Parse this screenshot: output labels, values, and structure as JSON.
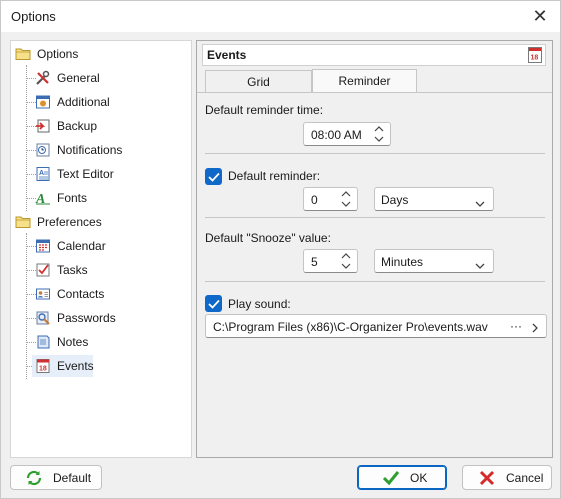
{
  "window": {
    "title": "Options",
    "close_glyph": "✕"
  },
  "tree": {
    "groups": [
      {
        "label": "Options",
        "icon": "folder-icon"
      },
      {
        "label": "Preferences",
        "icon": "folder-icon"
      }
    ],
    "options_items": [
      {
        "label": "General",
        "icon": "tools-icon"
      },
      {
        "label": "Additional",
        "icon": "settings-window-icon"
      },
      {
        "label": "Backup",
        "icon": "backup-icon"
      },
      {
        "label": "Notifications",
        "icon": "notifications-icon"
      },
      {
        "label": "Text Editor",
        "icon": "text-editor-icon"
      },
      {
        "label": "Fonts",
        "icon": "fonts-icon"
      }
    ],
    "preferences_items": [
      {
        "label": "Calendar",
        "icon": "calendar-icon"
      },
      {
        "label": "Tasks",
        "icon": "tasks-icon"
      },
      {
        "label": "Contacts",
        "icon": "contacts-icon"
      },
      {
        "label": "Passwords",
        "icon": "passwords-icon"
      },
      {
        "label": "Notes",
        "icon": "notes-icon"
      },
      {
        "label": "Events",
        "icon": "events-icon",
        "selected": true
      }
    ]
  },
  "panel": {
    "title": "Events",
    "header_icon": "events-icon",
    "icon_text": "18",
    "tabs": [
      {
        "label": "Grid",
        "active": false
      },
      {
        "label": "Reminder",
        "active": true
      }
    ],
    "reminder_time_label": "Default reminder time:",
    "reminder_time_value": "08:00 AM",
    "default_reminder_label": "Default reminder:",
    "default_reminder_checked": true,
    "default_reminder_value": "0",
    "default_reminder_unit": "Days",
    "snooze_label": "Default \"Snooze\" value:",
    "snooze_value": "5",
    "snooze_unit": "Minutes",
    "play_sound_label": "Play sound:",
    "play_sound_checked": true,
    "sound_path": "C:\\Program Files (x86)\\C-Organizer Pro\\events.wav",
    "browse_glyph": "···"
  },
  "footer": {
    "default_label": "Default",
    "ok_label": "OK",
    "cancel_label": "Cancel"
  },
  "colors": {
    "accent": "#1068c8",
    "selection": "#e5eef9",
    "ok_green": "#2e9e2e",
    "cancel_red": "#d42a2a"
  }
}
